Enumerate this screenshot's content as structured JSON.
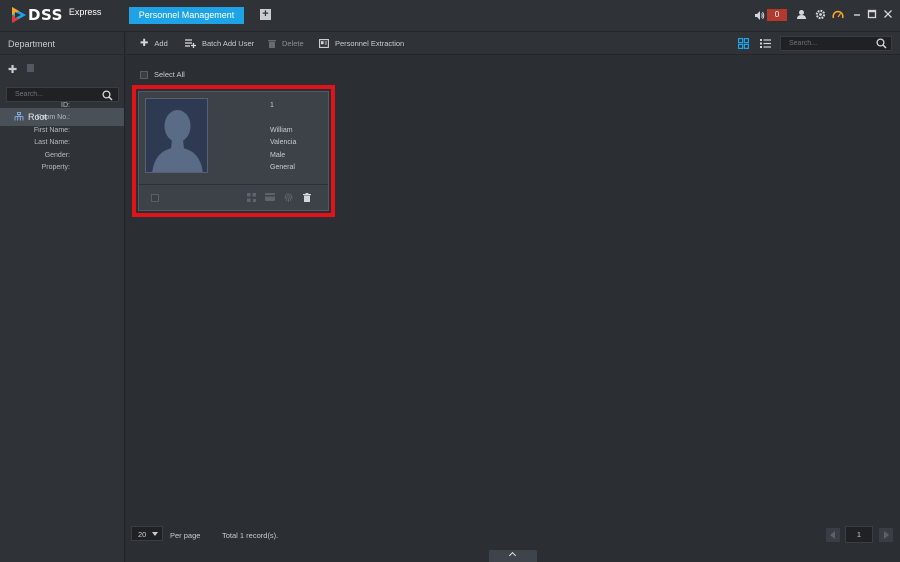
{
  "app": {
    "logo_text": "DSS",
    "logo_subtitle": "Express",
    "active_tab": "Personnel Management",
    "alarm_count": "0"
  },
  "sidebar": {
    "title": "Department",
    "search_placeholder": "Search...",
    "tree": [
      {
        "label": "Root"
      }
    ]
  },
  "toolbar": {
    "add": "Add",
    "batch_add": "Batch Add User",
    "delete": "Delete",
    "extraction": "Personnel Extraction",
    "search_placeholder": "Search..."
  },
  "main": {
    "select_all": "Select All",
    "cards": [
      {
        "fields": [
          {
            "key": "ID:",
            "value": "1"
          },
          {
            "key": "Room No.:",
            "value": ""
          },
          {
            "key": "First Name:",
            "value": "William"
          },
          {
            "key": "Last Name:",
            "value": "Valencia"
          },
          {
            "key": "Gender:",
            "value": "Male"
          },
          {
            "key": "Property:",
            "value": "General"
          }
        ],
        "highlight_color": "#e0131a"
      }
    ]
  },
  "pager": {
    "page_size": "20",
    "per_page_label": "Per page",
    "total_text": "Total 1 record(s).",
    "current_page": "1"
  },
  "colors": {
    "accent": "#1ea3e6",
    "background": "#2b2e33",
    "panel": "#2f3237"
  }
}
